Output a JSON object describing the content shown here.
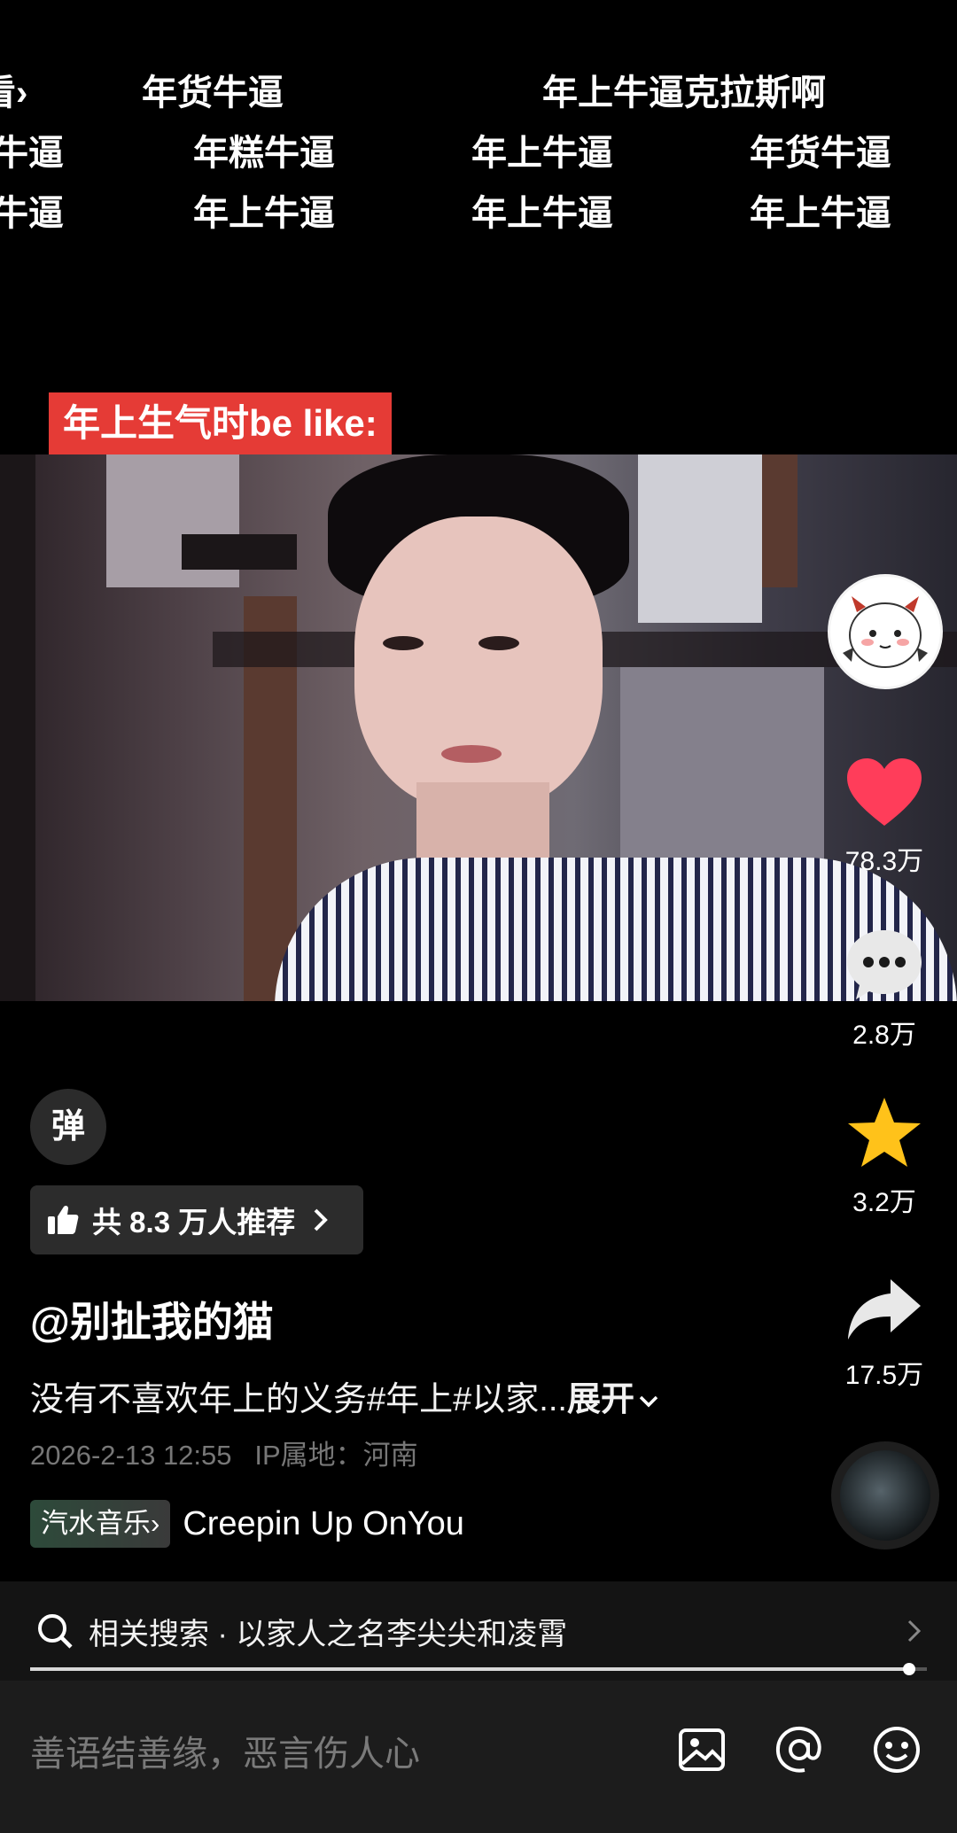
{
  "danmu": [
    {
      "text": "看"
    },
    {
      "text": "年货牛逼"
    },
    {
      "text": "年上牛逼克拉斯啊"
    },
    {
      "text": "牛逼"
    },
    {
      "text": "年糕牛逼"
    },
    {
      "text": "年上牛逼"
    },
    {
      "text": "年货牛逼"
    },
    {
      "text": "牛逼"
    },
    {
      "text": "年上牛逼"
    },
    {
      "text": "年上牛逼"
    },
    {
      "text": "年上牛逼"
    }
  ],
  "video": {
    "caption": "年上生气时be like:"
  },
  "sidebar": {
    "likes": "78.3万",
    "comments": "2.8万",
    "favorites": "3.2万",
    "shares": "17.5万"
  },
  "colors": {
    "like": "#ff3d5a",
    "favorite": "#ffc21a",
    "caption_bg": "#e53b36"
  },
  "info": {
    "danmu_toggle": "弹",
    "recommend": "共 8.3 万人推荐",
    "author": "@别扯我的猫",
    "description": "没有不喜欢年上的义务#年上#以家...",
    "expand": "展开",
    "date": "2026-2-13 12:55",
    "ip": "IP属地：河南",
    "music_tag": "汽水音乐",
    "music_name": "Creepin Up OnYou"
  },
  "related": {
    "text": "相关搜索 · 以家人之名李尖尖和凌霄"
  },
  "progress": {
    "fraction": 0.98
  },
  "comment": {
    "placeholder": "善语结善缘，恶言伤人心"
  }
}
